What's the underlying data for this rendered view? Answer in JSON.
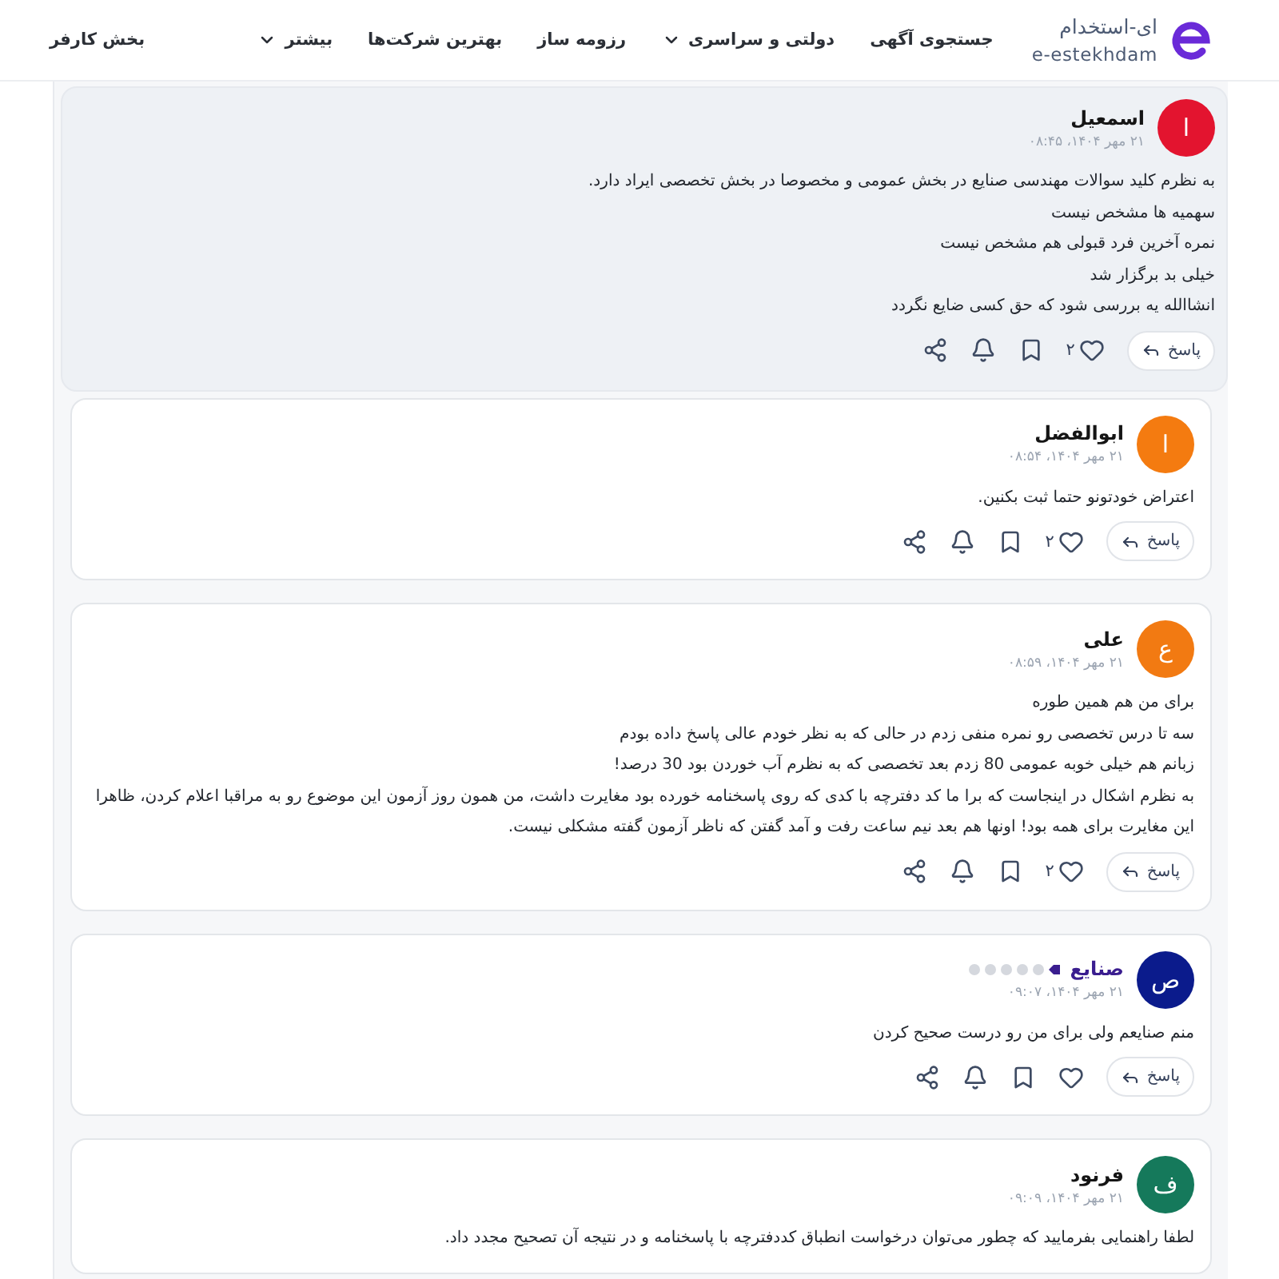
{
  "header": {
    "logo": {
      "title": "ای-استخدام",
      "subtitle": "e-estekhdam"
    },
    "nav": [
      {
        "label": "جستجوی آگهی",
        "dropdown": false
      },
      {
        "label": "دولتی و سراسری",
        "dropdown": true
      },
      {
        "label": "رزومه ساز",
        "dropdown": false
      },
      {
        "label": "بهترین شرکت‌ها",
        "dropdown": false
      },
      {
        "label": "بیشتر",
        "dropdown": true
      }
    ],
    "employer_link": "بخش کارفر"
  },
  "comments": [
    {
      "avatar": {
        "letter": "ا",
        "color": "#e3142f"
      },
      "name": "اسمعیل",
      "name_highlighted": false,
      "highlighted": true,
      "date": "۲۱ مهر ۱۴۰۴، ۰۸:۴۵",
      "lines": [
        "به نظرم کلید سوالات مهندسی صنایع در بخش عمومی و مخصوصا در بخش تخصصی ایراد دارد.",
        "سهمیه ها مشخص نیست",
        "نمره آخرین فرد قبولی هم مشخص نیست",
        "خیلی بد برگزار شد",
        "انشاالله یه بررسی شود که حق کسی ضایع نگردد"
      ],
      "actions": {
        "reply": "پاسخ",
        "likes": "۲"
      }
    },
    {
      "avatar": {
        "letter": "ا",
        "color": "#f47b10"
      },
      "name": "ابوالفضل",
      "name_highlighted": false,
      "highlighted": false,
      "date": "۲۱ مهر ۱۴۰۴، ۰۸:۵۴",
      "lines": [
        "اعتراض خودتونو حتما ثبت بکنین."
      ],
      "actions": {
        "reply": "پاسخ",
        "likes": "۲"
      }
    },
    {
      "avatar": {
        "letter": "ع",
        "color": "#f27a12"
      },
      "name": "علی",
      "name_highlighted": false,
      "highlighted": false,
      "date": "۲۱ مهر ۱۴۰۴، ۰۸:۵۹",
      "lines": [
        "برای من هم همین طوره",
        "سه تا درس تخصصی رو نمره منفی زدم در حالی که به نظر خودم عالی پاسخ داده بودم",
        "زبانم هم خیلی خوبه عمومی 80 زدم بعد تخصصی که به نظرم آب خوردن بود 30 درصد!",
        "به نظرم اشکال در اینجاست که برا ما کد دفترچه با کدی که روی پاسخنامه خورده بود مغایرت داشت، من همون روز آزمون این موضوع رو به مراقبا اعلام کردن، ظاهرا این مغایرت برای همه بود! اونها هم بعد نیم ساعت رفت و آمد گفتن که ناظر آزمون گفته مشکلی نیست."
      ],
      "actions": {
        "reply": "پاسخ",
        "likes": "۲"
      }
    },
    {
      "avatar": {
        "letter": "ص",
        "color": "#0b1b8c"
      },
      "name": "صنایع",
      "name_highlighted": true,
      "highlighted": false,
      "rank": {
        "stars": 1
      },
      "date": "۲۱ مهر ۱۴۰۴، ۰۹:۰۷",
      "lines": [
        "منم صنایعم ولی برای من رو درست صحیح کردن"
      ],
      "actions": {
        "reply": "پاسخ"
      }
    },
    {
      "avatar": {
        "letter": "ف",
        "color": "#15795b"
      },
      "name": "فرنود",
      "name_highlighted": false,
      "highlighted": false,
      "date": "۲۱ مهر ۱۴۰۴، ۰۹:۰۹",
      "lines": [
        "لطفا راهنمایی بفرمایید که چطور می‌توان درخواست انطباق کددفترچه با پاسخنامه و در نتیجه آن تصحیح مجدد داد."
      ]
    }
  ]
}
